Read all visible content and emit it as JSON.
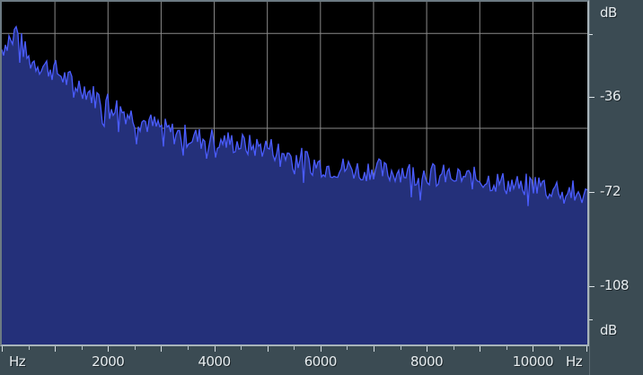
{
  "window": {
    "unit_left": "Hz",
    "unit_right": "Hz",
    "db_unit_top": "dB",
    "db_unit_bottom": "dB"
  },
  "chart_data": {
    "type": "area",
    "x_ticks": [
      2000,
      4000,
      6000,
      8000,
      10000
    ],
    "x_tick_labels": [
      "2000",
      "4000",
      "6000",
      "8000",
      "10000"
    ],
    "y_ticks": [
      -36,
      -72,
      -108
    ],
    "y_tick_labels": [
      "-36",
      "-72",
      "-108"
    ],
    "xlim": [
      0,
      11025
    ],
    "ylim": [
      -130,
      0
    ],
    "grid": true,
    "colors": {
      "fill": "#24307a",
      "line": "#4a5cff",
      "grid": "#8a8a8a",
      "bg": "#000000"
    },
    "series": [
      {
        "x": [
          0,
          250,
          500,
          750,
          1000,
          1250,
          1500,
          1750,
          2000,
          2250,
          2500,
          2750,
          3000,
          3250,
          3500,
          3750,
          4000,
          4250,
          4500,
          4750,
          5000,
          5250,
          5500,
          5750,
          6000,
          6250,
          6500,
          6750,
          7000,
          7250,
          7500,
          7750,
          8000,
          8250,
          8500,
          8750,
          9000,
          9250,
          9500,
          9750,
          10000,
          10250,
          10500,
          10750,
          11025
        ],
        "y": [
          -18,
          -10,
          -22,
          -24,
          -26,
          -30,
          -32,
          -36,
          -38,
          -41,
          -44,
          -46,
          -48,
          -50,
          -51,
          -52,
          -52,
          -53,
          -54,
          -55,
          -55,
          -57,
          -59,
          -60,
          -62,
          -63,
          -63,
          -64,
          -63,
          -65,
          -64,
          -65,
          -65,
          -66,
          -66,
          -67,
          -67,
          -68,
          -69,
          -70,
          -69,
          -70,
          -71,
          -72,
          -74
        ]
      }
    ]
  }
}
